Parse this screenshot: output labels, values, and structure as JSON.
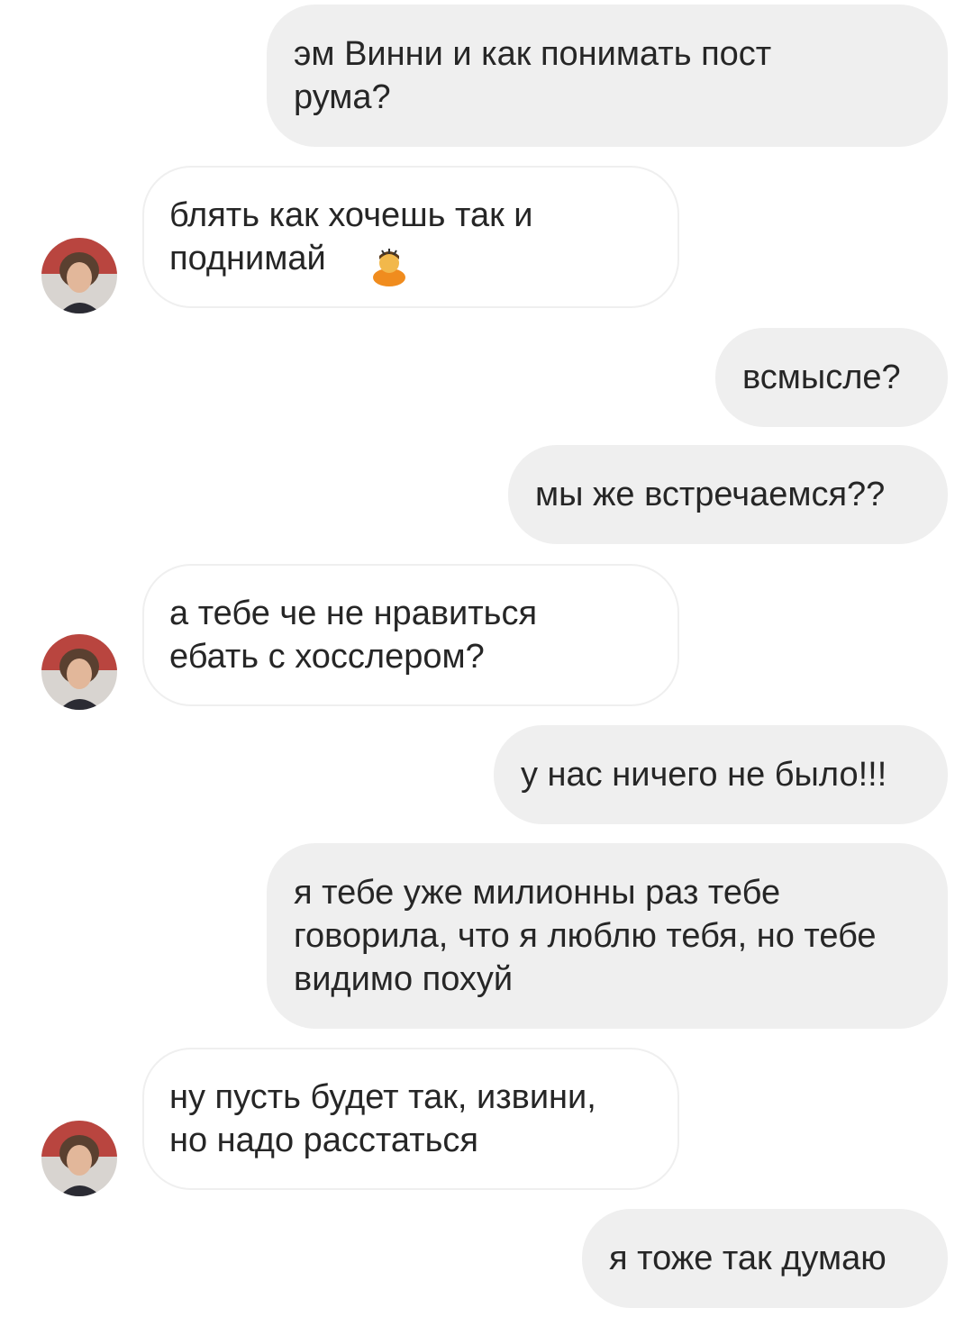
{
  "chat": {
    "messages": [
      {
        "from": "me",
        "text": "эм Винни и как понимать пост\nрума?"
      },
      {
        "from": "them",
        "text": "блять как хочешь так и\nподнимай",
        "emoji": "person-gesturing-no-icon"
      },
      {
        "from": "me",
        "text": "всмысле?"
      },
      {
        "from": "me",
        "text": "мы же встречаемся??"
      },
      {
        "from": "them",
        "text": "а тебе че не нравиться\nебать с хосслером?"
      },
      {
        "from": "me",
        "text": "у нас ничего не было!!!"
      },
      {
        "from": "me",
        "text": "я тебе уже милионны раз тебе\nговорила, что я люблю тебя, но тебе\nвидимо похуй"
      },
      {
        "from": "them",
        "text": "ну пусть будет так, извини,\nно надо расстаться"
      },
      {
        "from": "me",
        "text": "я тоже так думаю"
      }
    ]
  },
  "colors": {
    "outgoing_bubble": "#efefef",
    "incoming_border": "#efefef",
    "text": "#262626",
    "background": "#ffffff"
  }
}
